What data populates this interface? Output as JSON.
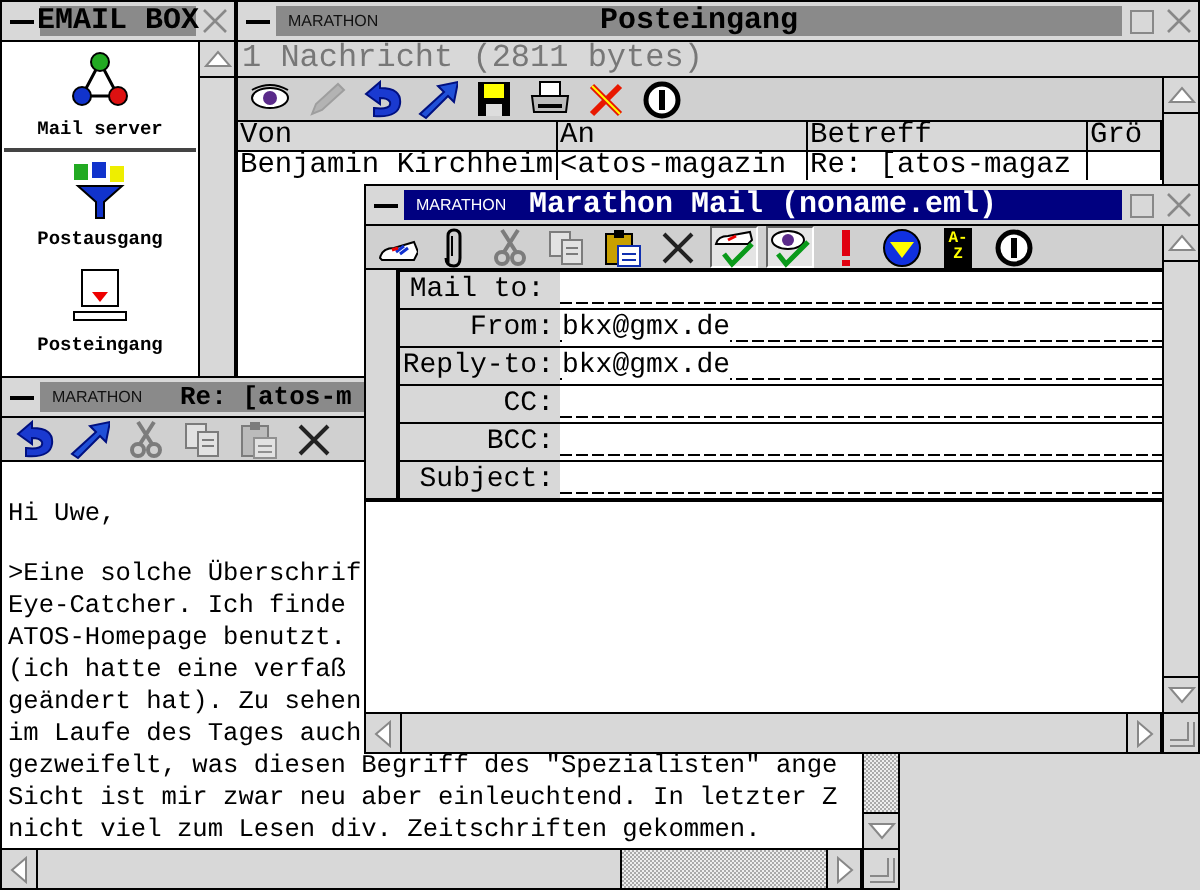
{
  "windows": [
    {
      "kind": "sidebar",
      "title": "EMAIL BOX",
      "active": false,
      "items": [
        {
          "kind": "server",
          "label": "Mail server"
        },
        {
          "kind": "outbox",
          "label": "Postausgang"
        },
        {
          "kind": "inbox",
          "label": "Posteingang"
        }
      ]
    },
    {
      "kind": "mailbox",
      "app": "MARATHON",
      "title": "Posteingang",
      "active": false,
      "info": "1 Nachricht (2811 bytes)",
      "toolbar": [
        {
          "kind": "eye",
          "disabled": false
        },
        {
          "kind": "pen",
          "disabled": true
        },
        {
          "kind": "reply",
          "disabled": false
        },
        {
          "kind": "forward",
          "disabled": false
        },
        {
          "kind": "disk",
          "disabled": false
        },
        {
          "kind": "printer",
          "disabled": false
        },
        {
          "kind": "delete",
          "disabled": false
        },
        {
          "kind": "info",
          "disabled": false
        }
      ],
      "table": {
        "columns": [
          "Von",
          "An",
          "Betreff",
          "Grö"
        ],
        "rows": [
          [
            "Benjamin Kirchheim",
            "<atos-magazin",
            "Re: [atos-magaz"
          ]
        ]
      }
    },
    {
      "kind": "reader",
      "app": "MARATHON",
      "title": "Re: [atos-m",
      "active": false,
      "toolbar": [
        {
          "kind": "reply",
          "disabled": false
        },
        {
          "kind": "forward",
          "disabled": false
        },
        {
          "kind": "cut",
          "disabled": true
        },
        {
          "kind": "copy",
          "disabled": true
        },
        {
          "kind": "paste",
          "disabled": true
        },
        {
          "kind": "cancel",
          "disabled": false
        }
      ],
      "paragraphs": [
        [
          "Hi Uwe,"
        ],
        [
          ">Eine solche Überschrif",
          "Eye-Catcher. Ich finde",
          "ATOS-Homepage benutzt.",
          "(ich hatte eine verfaß",
          "geändert hat). Zu sehen",
          "im Laufe des Tages auch",
          "gezweifelt, was diesen Begriff des \"Spezialisten\" ange",
          "Sicht ist mir zwar neu aber einleuchtend. In letzter Z",
          "nicht viel zum Lesen div. Zeitschriften gekommen."
        ]
      ]
    },
    {
      "kind": "composer",
      "app": "MARATHON",
      "title": "Marathon Mail (noname.eml)",
      "active": true,
      "toolbar": [
        {
          "kind": "send",
          "disabled": false
        },
        {
          "kind": "clip",
          "disabled": false
        },
        {
          "kind": "cut",
          "disabled": true
        },
        {
          "kind": "copy",
          "disabled": true
        },
        {
          "kind": "paste",
          "disabled": false
        },
        {
          "kind": "cancel",
          "disabled": false
        },
        {
          "kind": "sendcheck",
          "disabled": false,
          "on": true
        },
        {
          "kind": "eyecheck",
          "disabled": false,
          "on": true
        },
        {
          "kind": "urgent",
          "disabled": false
        },
        {
          "kind": "priority",
          "disabled": false
        },
        {
          "kind": "book",
          "disabled": false,
          "label": "A-Z"
        },
        {
          "kind": "info",
          "disabled": false
        }
      ],
      "fields": [
        {
          "label": "Mail to:"
        },
        {
          "label": "From:",
          "value": "bkx@gmx.de"
        },
        {
          "label": "Reply-to:",
          "value": "bkx@gmx.de"
        },
        {
          "label": "CC:"
        },
        {
          "label": "BCC:"
        },
        {
          "label": "Subject:"
        }
      ]
    }
  ]
}
